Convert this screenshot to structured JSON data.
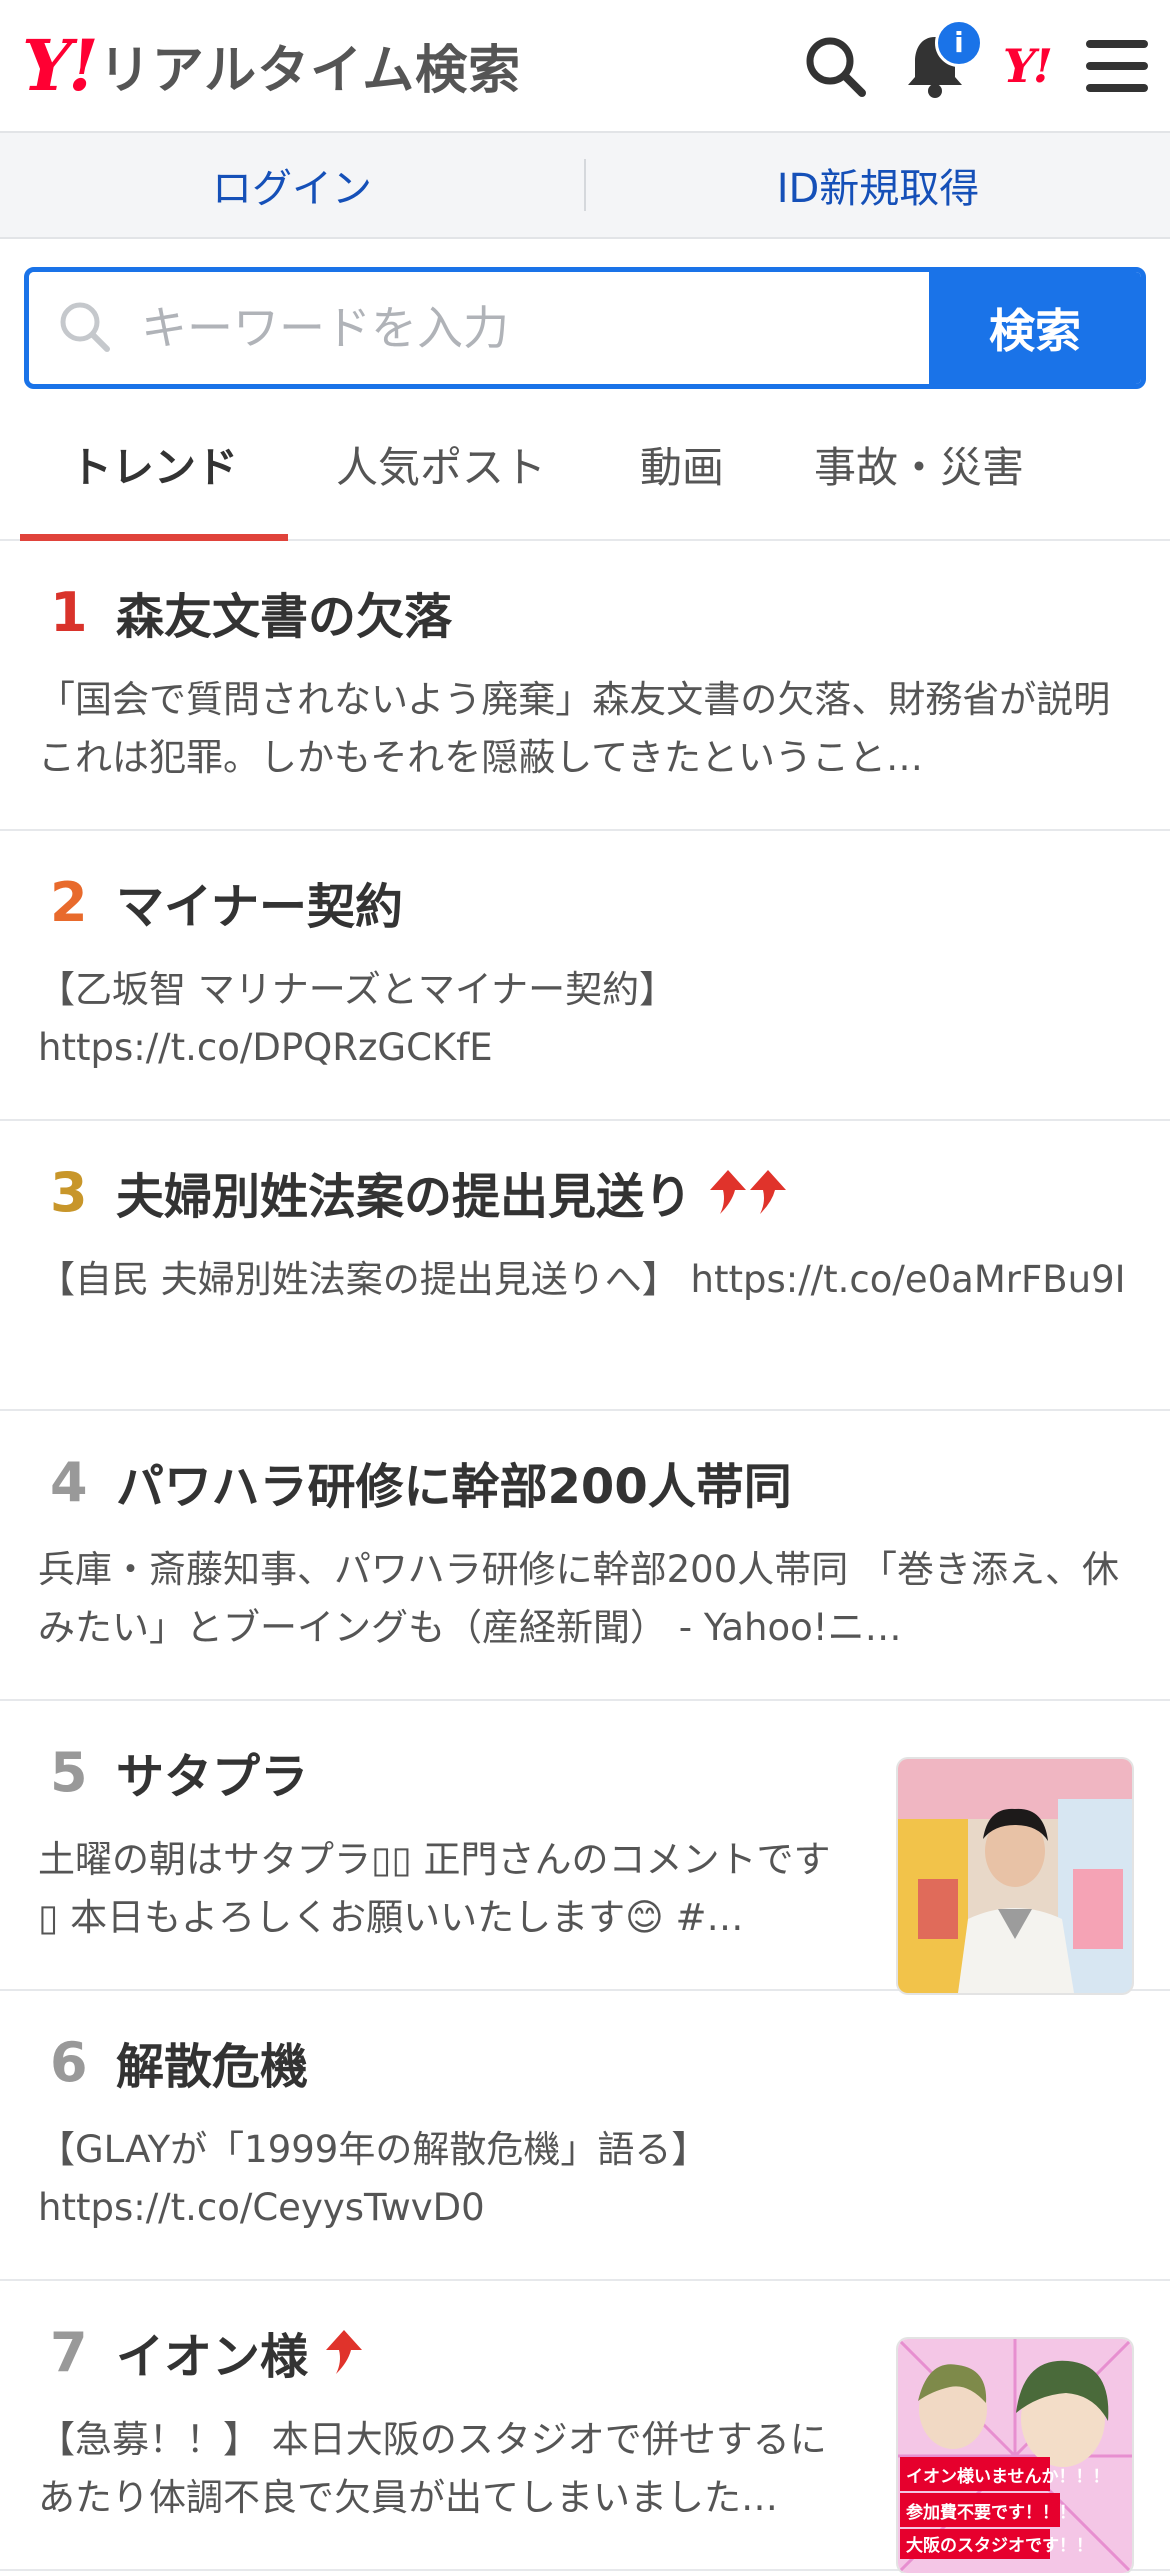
{
  "header": {
    "logo_mark": "Y!",
    "logo_text": "リアルタイム検索",
    "notification_badge": "i",
    "yj_mark": "Y!"
  },
  "login_bar": {
    "login": "ログイン",
    "signup": "ID新規取得"
  },
  "search": {
    "placeholder": "キーワードを入力",
    "button": "検索"
  },
  "tabs": [
    {
      "label": "トレンド",
      "active": true
    },
    {
      "label": "人気ポスト",
      "active": false
    },
    {
      "label": "動画",
      "active": false
    },
    {
      "label": "事故・災害",
      "active": false
    }
  ],
  "trends": [
    {
      "rank": "1",
      "title": "森友文書の欠落",
      "snippet": "「国会で質問されないよう廃棄」森友文書の欠落、財務省が説明 これは犯罪。しかもそれを隠蔽してきたということ…",
      "arrows": 0,
      "rank_color": "#d9332b"
    },
    {
      "rank": "2",
      "title": "マイナー契約",
      "snippet": "【乙坂智 マリナーズとマイナー契約】 https://t.co/DPQRzGCKfE",
      "arrows": 0,
      "rank_color": "#e86a2c"
    },
    {
      "rank": "3",
      "title": "夫婦別姓法案の提出見送り",
      "snippet": "【自民 夫婦別姓法案の提出見送りへ】 https://t.co/e0aMrFBu9I",
      "arrows": 2,
      "rank_color": "#c8962a"
    },
    {
      "rank": "4",
      "title": "パワハラ研修に幹部200人帯同",
      "snippet": "兵庫・斎藤知事、パワハラ研修に幹部200人帯同 「巻き添え、休みたい」とブーイングも（産経新聞） - Yahoo!ニ…",
      "arrows": 0,
      "rank_color": "#999999"
    },
    {
      "rank": "5",
      "title": "サタプラ",
      "snippet": "土曜の朝はサタプラ▯▯ 正門さんのコメントです▯ 本日もよろしくお願いいたします😊 #…",
      "arrows": 0,
      "rank_color": "#999999",
      "thumb": "person"
    },
    {
      "rank": "6",
      "title": "解散危機",
      "snippet": "【GLAYが「1999年の解散危機」語る】 https://t.co/CeyysTwvD0",
      "arrows": 0,
      "rank_color": "#999999"
    },
    {
      "rank": "7",
      "title": "イオン様",
      "snippet": "【急募！！】 本日大阪のスタジオで併せするにあたり体調不良で欠員が出てしまいました…",
      "arrows": 1,
      "rank_color": "#999999",
      "thumb": "anime",
      "thumb_text": [
        "イオン様いませんか！！！",
        "参加費不要です！！！",
        "大阪のスタジオです！！"
      ]
    }
  ],
  "colors": {
    "accent": "#1a73e8",
    "tab_underline": "#e0433b",
    "brand_red": "#ff0033",
    "arrow_red": "#e0332b"
  }
}
